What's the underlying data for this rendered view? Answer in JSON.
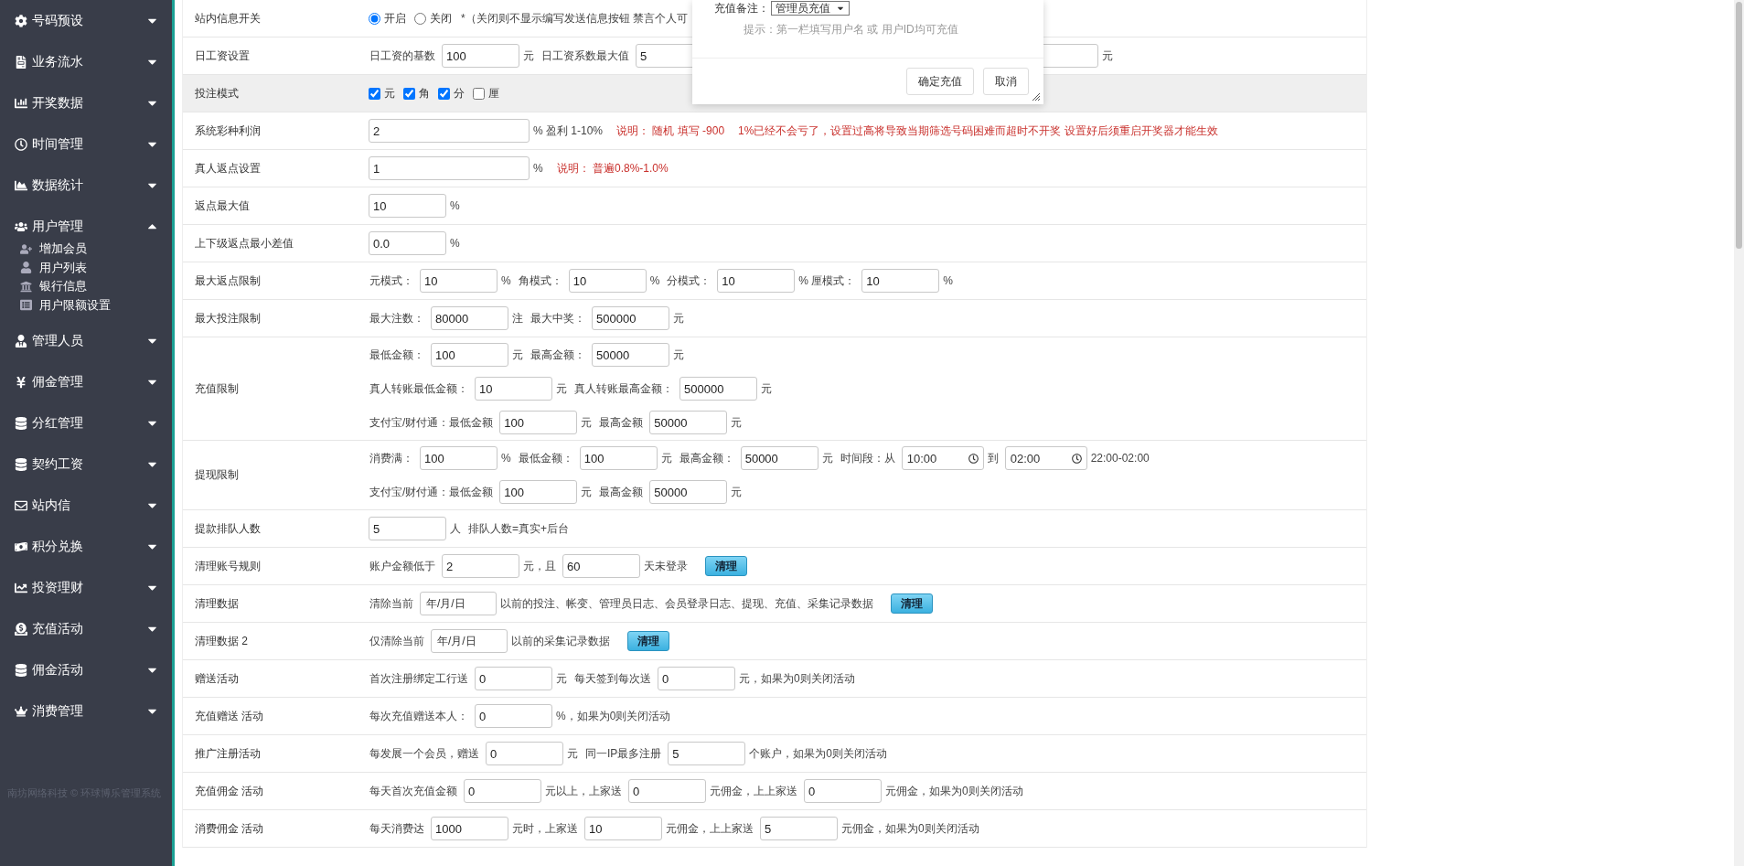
{
  "sidebar": {
    "items": [
      {
        "label": "号码预设",
        "expanded": false
      },
      {
        "label": "业务流水",
        "expanded": false
      },
      {
        "label": "开奖数据",
        "expanded": false
      },
      {
        "label": "时间管理",
        "expanded": false
      },
      {
        "label": "数据统计",
        "expanded": false
      },
      {
        "label": "用户管理",
        "expanded": true,
        "children": [
          {
            "label": "增加会员"
          },
          {
            "label": "用户列表"
          },
          {
            "label": "银行信息"
          },
          {
            "label": "用户限额设置"
          }
        ]
      },
      {
        "label": "管理人员",
        "expanded": false
      },
      {
        "label": "佣金管理",
        "expanded": false
      },
      {
        "label": "分红管理",
        "expanded": false
      },
      {
        "label": "契约工资",
        "expanded": false
      },
      {
        "label": "站内信",
        "expanded": false
      },
      {
        "label": "积分兑换",
        "expanded": false
      },
      {
        "label": "投资理财",
        "expanded": false
      },
      {
        "label": "充值活动",
        "expanded": false
      },
      {
        "label": "佣金活动",
        "expanded": false
      },
      {
        "label": "消费管理",
        "expanded": false
      }
    ],
    "footer": "南坊网络科技 © 环球博乐管理系统"
  },
  "form": {
    "rows": [
      {
        "label": "站内信息开关",
        "shaded": false,
        "lines": [
          [
            {
              "kind": "radio",
              "label": "开启",
              "selected": true
            },
            {
              "kind": "radio",
              "label": "关闭",
              "selected": false
            },
            {
              "kind": "text",
              "text": "*（关闭则不显示编写发送信息按钮 禁言个人可"
            }
          ]
        ]
      },
      {
        "label": "日工资设置",
        "shaded": false,
        "lines": [
          [
            {
              "kind": "text",
              "text": "日工资的基数"
            },
            {
              "kind": "input",
              "value": "100"
            },
            {
              "kind": "text",
              "text": "元"
            },
            {
              "kind": "text",
              "text": "日工资系数最大值"
            },
            {
              "kind": "input",
              "value": "5"
            },
            {
              "kind": "gap"
            },
            {
              "kind": "input"
            },
            {
              "kind": "text",
              "text": "元"
            }
          ]
        ]
      },
      {
        "label": "投注模式",
        "shaded": true,
        "lines": [
          [
            {
              "kind": "checkbox",
              "label": "元",
              "checked": true
            },
            {
              "kind": "checkbox",
              "label": "角",
              "checked": true
            },
            {
              "kind": "checkbox",
              "label": "分",
              "checked": true
            },
            {
              "kind": "checkbox",
              "label": "厘",
              "checked": false
            }
          ]
        ]
      },
      {
        "label": "系统彩种利润",
        "shaded": false,
        "lines": [
          [
            {
              "kind": "wide-input",
              "value": "2"
            },
            {
              "kind": "text",
              "text": "% 盈利 1-10%"
            },
            {
              "kind": "note",
              "text": "说明： 随机 填写 -900"
            },
            {
              "kind": "note",
              "text": "1%已经不会亏了，设置过高将导致当期筛选号码困难而超时不开奖 设置好后须重启开奖器才能生效"
            }
          ]
        ]
      },
      {
        "label": "真人返点设置",
        "shaded": false,
        "lines": [
          [
            {
              "kind": "wide-input",
              "value": "1"
            },
            {
              "kind": "text",
              "text": "%"
            },
            {
              "kind": "note",
              "text": "说明： 普遍0.8%-1.0%"
            }
          ]
        ]
      },
      {
        "label": "返点最大值",
        "shaded": false,
        "lines": [
          [
            {
              "kind": "input",
              "value": "10"
            },
            {
              "kind": "text",
              "text": "%"
            }
          ]
        ]
      },
      {
        "label": "上下级返点最小差值",
        "shaded": false,
        "lines": [
          [
            {
              "kind": "input",
              "value": "0.0"
            },
            {
              "kind": "text",
              "text": "%"
            }
          ]
        ]
      },
      {
        "label": "最大返点限制",
        "shaded": false,
        "lines": [
          [
            {
              "kind": "text",
              "text": "元模式："
            },
            {
              "kind": "input",
              "value": "10"
            },
            {
              "kind": "text",
              "text": "%"
            },
            {
              "kind": "text",
              "text": "角模式："
            },
            {
              "kind": "input",
              "value": "10"
            },
            {
              "kind": "text",
              "text": "%"
            },
            {
              "kind": "text",
              "text": "分模式："
            },
            {
              "kind": "input",
              "value": "10"
            },
            {
              "kind": "text",
              "text": "% 厘模式："
            },
            {
              "kind": "input",
              "value": "10"
            },
            {
              "kind": "text",
              "text": "%"
            }
          ]
        ]
      },
      {
        "label": "最大投注限制",
        "shaded": false,
        "lines": [
          [
            {
              "kind": "text",
              "text": "最大注数："
            },
            {
              "kind": "input",
              "value": "80000"
            },
            {
              "kind": "text",
              "text": "注"
            },
            {
              "kind": "text",
              "text": "最大中奖："
            },
            {
              "kind": "input",
              "value": "500000"
            },
            {
              "kind": "text",
              "text": "元"
            }
          ]
        ]
      },
      {
        "label": "充值限制",
        "shaded": false,
        "lines": [
          [
            {
              "kind": "text",
              "text": "最低金额："
            },
            {
              "kind": "input",
              "value": "100"
            },
            {
              "kind": "text",
              "text": "元"
            },
            {
              "kind": "text",
              "text": "最高金额："
            },
            {
              "kind": "input",
              "value": "50000"
            },
            {
              "kind": "text",
              "text": "元"
            }
          ],
          [
            {
              "kind": "text",
              "text": "真人转账最低金额："
            },
            {
              "kind": "input",
              "value": "10"
            },
            {
              "kind": "text",
              "text": "元"
            },
            {
              "kind": "text",
              "text": "真人转账最高金额："
            },
            {
              "kind": "input",
              "value": "500000"
            },
            {
              "kind": "text",
              "text": "元"
            }
          ],
          [
            {
              "kind": "text",
              "text": "支付宝/财付通：最低金额"
            },
            {
              "kind": "input",
              "value": "100"
            },
            {
              "kind": "text",
              "text": "元"
            },
            {
              "kind": "text",
              "text": "最高金额"
            },
            {
              "kind": "input",
              "value": "50000"
            },
            {
              "kind": "text",
              "text": "元"
            }
          ]
        ]
      },
      {
        "label": "提现限制",
        "shaded": false,
        "lines": [
          [
            {
              "kind": "text",
              "text": "消费满："
            },
            {
              "kind": "input",
              "value": "100"
            },
            {
              "kind": "text",
              "text": "%"
            },
            {
              "kind": "text",
              "text": "最低金额："
            },
            {
              "kind": "input",
              "value": "100"
            },
            {
              "kind": "text",
              "text": "元"
            },
            {
              "kind": "text",
              "text": "最高金额："
            },
            {
              "kind": "input",
              "value": "50000"
            },
            {
              "kind": "text",
              "text": "元"
            },
            {
              "kind": "text",
              "text": "时间段：从"
            },
            {
              "kind": "time",
              "value": "10:00"
            },
            {
              "kind": "text",
              "text": "到"
            },
            {
              "kind": "time",
              "value": "02:00"
            },
            {
              "kind": "text",
              "text": "22:00-02:00"
            }
          ],
          [
            {
              "kind": "text",
              "text": "支付宝/财付通：最低金额"
            },
            {
              "kind": "input",
              "value": "100"
            },
            {
              "kind": "text",
              "text": "元"
            },
            {
              "kind": "text",
              "text": "最高金额"
            },
            {
              "kind": "input",
              "value": "50000"
            },
            {
              "kind": "text",
              "text": "元"
            }
          ]
        ]
      },
      {
        "label": "提款排队人数",
        "shaded": false,
        "lines": [
          [
            {
              "kind": "input",
              "value": "5"
            },
            {
              "kind": "text",
              "text": "人"
            },
            {
              "kind": "text",
              "text": "排队人数=真实+后台"
            }
          ]
        ]
      },
      {
        "label": "清理账号规则",
        "shaded": false,
        "lines": [
          [
            {
              "kind": "text",
              "text": "账户金额低于"
            },
            {
              "kind": "input",
              "value": "2"
            },
            {
              "kind": "text",
              "text": "元，且"
            },
            {
              "kind": "input",
              "value": "60"
            },
            {
              "kind": "text",
              "text": "天未登录"
            },
            {
              "kind": "button",
              "label": "清理"
            }
          ]
        ]
      },
      {
        "label": "清理数据",
        "shaded": false,
        "lines": [
          [
            {
              "kind": "text",
              "text": "清除当前"
            },
            {
              "kind": "date",
              "placeholder": "年/月/日"
            },
            {
              "kind": "text",
              "text": "以前的投注、帐变、管理员日志、会员登录日志、提现、充值、采集记录数据"
            },
            {
              "kind": "button",
              "label": "清理"
            }
          ]
        ]
      },
      {
        "label": "清理数据 2",
        "shaded": false,
        "lines": [
          [
            {
              "kind": "text",
              "text": "仅清除当前"
            },
            {
              "kind": "date",
              "placeholder": "年/月/日"
            },
            {
              "kind": "text",
              "text": "以前的采集记录数据"
            },
            {
              "kind": "button",
              "label": "清理"
            }
          ]
        ]
      },
      {
        "label": "赠送活动",
        "shaded": false,
        "lines": [
          [
            {
              "kind": "text",
              "text": "首次注册绑定工行送"
            },
            {
              "kind": "input",
              "value": "0"
            },
            {
              "kind": "text",
              "text": "元"
            },
            {
              "kind": "text",
              "text": "每天签到每次送"
            },
            {
              "kind": "input",
              "value": "0"
            },
            {
              "kind": "text",
              "text": "元，如果为0则关闭活动"
            }
          ]
        ]
      },
      {
        "label": "充值赠送 活动",
        "shaded": false,
        "lines": [
          [
            {
              "kind": "text",
              "text": "每次充值赠送本人："
            },
            {
              "kind": "input",
              "value": "0"
            },
            {
              "kind": "text",
              "text": "%，如果为0则关闭活动"
            }
          ]
        ]
      },
      {
        "label": "推广注册活动",
        "shaded": false,
        "lines": [
          [
            {
              "kind": "text",
              "text": "每发展一个会员，赠送"
            },
            {
              "kind": "input",
              "value": "0"
            },
            {
              "kind": "text",
              "text": "元"
            },
            {
              "kind": "text",
              "text": "同一IP最多注册"
            },
            {
              "kind": "input",
              "value": "5"
            },
            {
              "kind": "text",
              "text": "个账户，如果为0则关闭活动"
            }
          ]
        ]
      },
      {
        "label": "充值佣金 活动",
        "shaded": false,
        "lines": [
          [
            {
              "kind": "text",
              "text": "每天首次充值金额"
            },
            {
              "kind": "input",
              "value": "0"
            },
            {
              "kind": "text",
              "text": "元以上，上家送"
            },
            {
              "kind": "input",
              "value": "0"
            },
            {
              "kind": "text",
              "text": "元佣金，上上家送"
            },
            {
              "kind": "input",
              "value": "0"
            },
            {
              "kind": "text",
              "text": "元佣金，如果为0则关闭活动"
            }
          ]
        ]
      },
      {
        "label": "消费佣金 活动",
        "shaded": false,
        "lines": [
          [
            {
              "kind": "text",
              "text": "每天消费达"
            },
            {
              "kind": "input",
              "value": "1000"
            },
            {
              "kind": "text",
              "text": "元时，上家送"
            },
            {
              "kind": "input",
              "value": "10"
            },
            {
              "kind": "text",
              "text": "元佣金，上上家送"
            },
            {
              "kind": "input",
              "value": "5"
            },
            {
              "kind": "text",
              "text": "元佣金，如果为0则关闭活动"
            }
          ]
        ]
      }
    ]
  },
  "dialog": {
    "field_label": "充值备注：",
    "select_value": "管理员充值",
    "hint": "提示：第一栏填写用户名 或 用户ID均可充值",
    "buttons": [
      "确定充值",
      "取消"
    ]
  }
}
